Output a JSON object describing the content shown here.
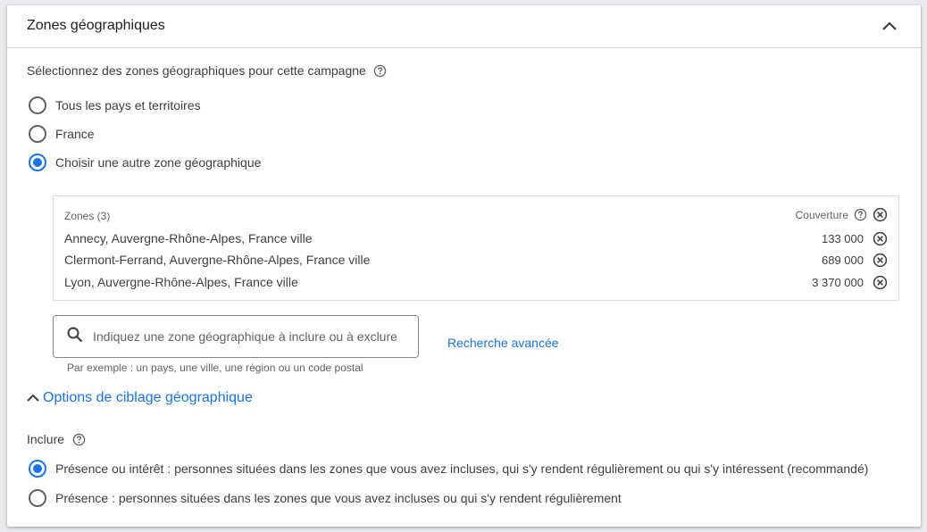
{
  "header": {
    "title": "Zones géographiques",
    "collapse_icon": "chevron-up-icon"
  },
  "locations": {
    "prompt": "Sélectionnez des zones géographiques pour cette campagne",
    "options": [
      {
        "label": "Tous les pays et territoires",
        "checked": false
      },
      {
        "label": "France",
        "checked": false
      },
      {
        "label": "Choisir une autre zone géographique",
        "checked": true
      }
    ]
  },
  "zones": {
    "header": "Zones (3)",
    "coverage_header": "Couverture",
    "rows": [
      {
        "name": "Annecy, Auvergne-Rhône-Alpes, France ville",
        "reach": "133 000"
      },
      {
        "name": "Clermont-Ferrand, Auvergne-Rhône-Alpes, France ville",
        "reach": "689 000"
      },
      {
        "name": "Lyon, Auvergne-Rhône-Alpes, France ville",
        "reach": "3 370 000"
      }
    ]
  },
  "search": {
    "placeholder": "Indiquez une zone géographique à inclure ou à exclure",
    "advanced_link": "Recherche avancée",
    "hint": "Par exemple : un pays, une ville, une région ou un code postal"
  },
  "targeting": {
    "toggle_label": "Options de ciblage géographique",
    "include_label": "Inclure",
    "options": [
      {
        "label": "Présence ou intérêt : personnes situées dans les zones que vous avez incluses, qui s'y rendent régulièrement ou qui s'y intéressent (recommandé)",
        "checked": true
      },
      {
        "label": "Présence : personnes situées dans les zones que vous avez incluses ou qui s'y rendent régulièrement",
        "checked": false
      }
    ]
  },
  "colors": {
    "accent": "#1a73e8",
    "text": "#3c4043",
    "border": "#dadce0"
  }
}
